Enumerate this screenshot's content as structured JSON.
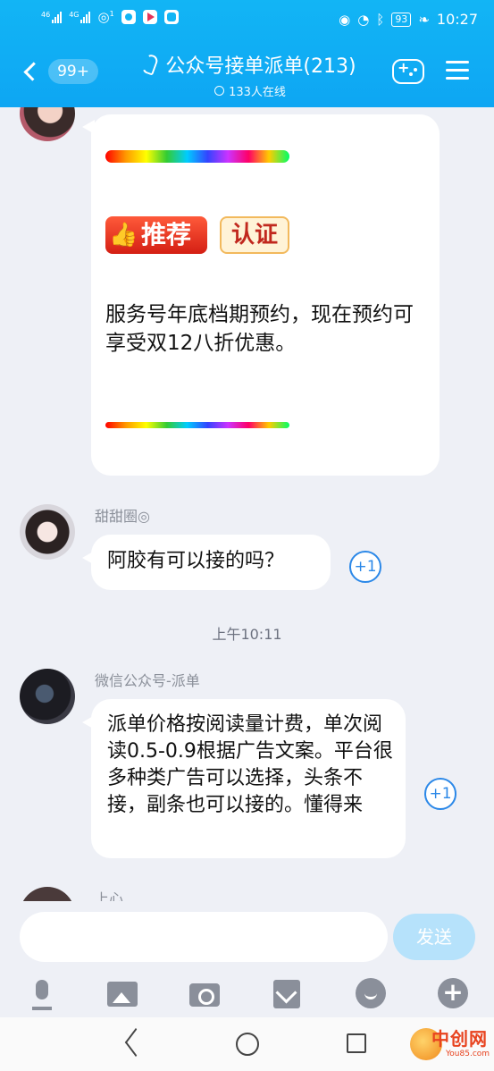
{
  "status_bar": {
    "signal_1_label": "46",
    "signal_2_label": "4G",
    "wifi_label": "1",
    "battery": "93",
    "time": "10:27"
  },
  "header": {
    "unread_badge": "99+",
    "title": "公众号接单派单(213)",
    "online_count": "133人在线",
    "icons": [
      "back-chevron-icon",
      "ear-icon",
      "game-controller-icon",
      "menu-icon"
    ]
  },
  "messages": [
    {
      "sender": "",
      "tag_recommend": "推荐",
      "tag_verified": "认证",
      "text": "服务号年底档期预约，现在预约可享受双12八折优惠。"
    },
    {
      "sender": "甜甜圈◎",
      "text": "阿胶有可以接的吗？",
      "plus_one": "+1"
    },
    {
      "sender": "微信公众号-派单",
      "text": "派单价格按阅读量计费，单次阅读0.5-0.9根据广告文案。平台很多种类广告可以选择，头条不接，副条也可以接的。懂得来",
      "plus_one": "+1"
    },
    {
      "sender": "上心"
    }
  ],
  "timestamp": "上午10:11",
  "input": {
    "value": "",
    "send_label": "发送"
  },
  "toolbar_icons": [
    "microphone-icon",
    "image-icon",
    "camera-icon",
    "red-envelope-icon",
    "emoji-icon",
    "plus-icon"
  ],
  "watermark": {
    "cn": "中创网",
    "en": "You85.com"
  }
}
